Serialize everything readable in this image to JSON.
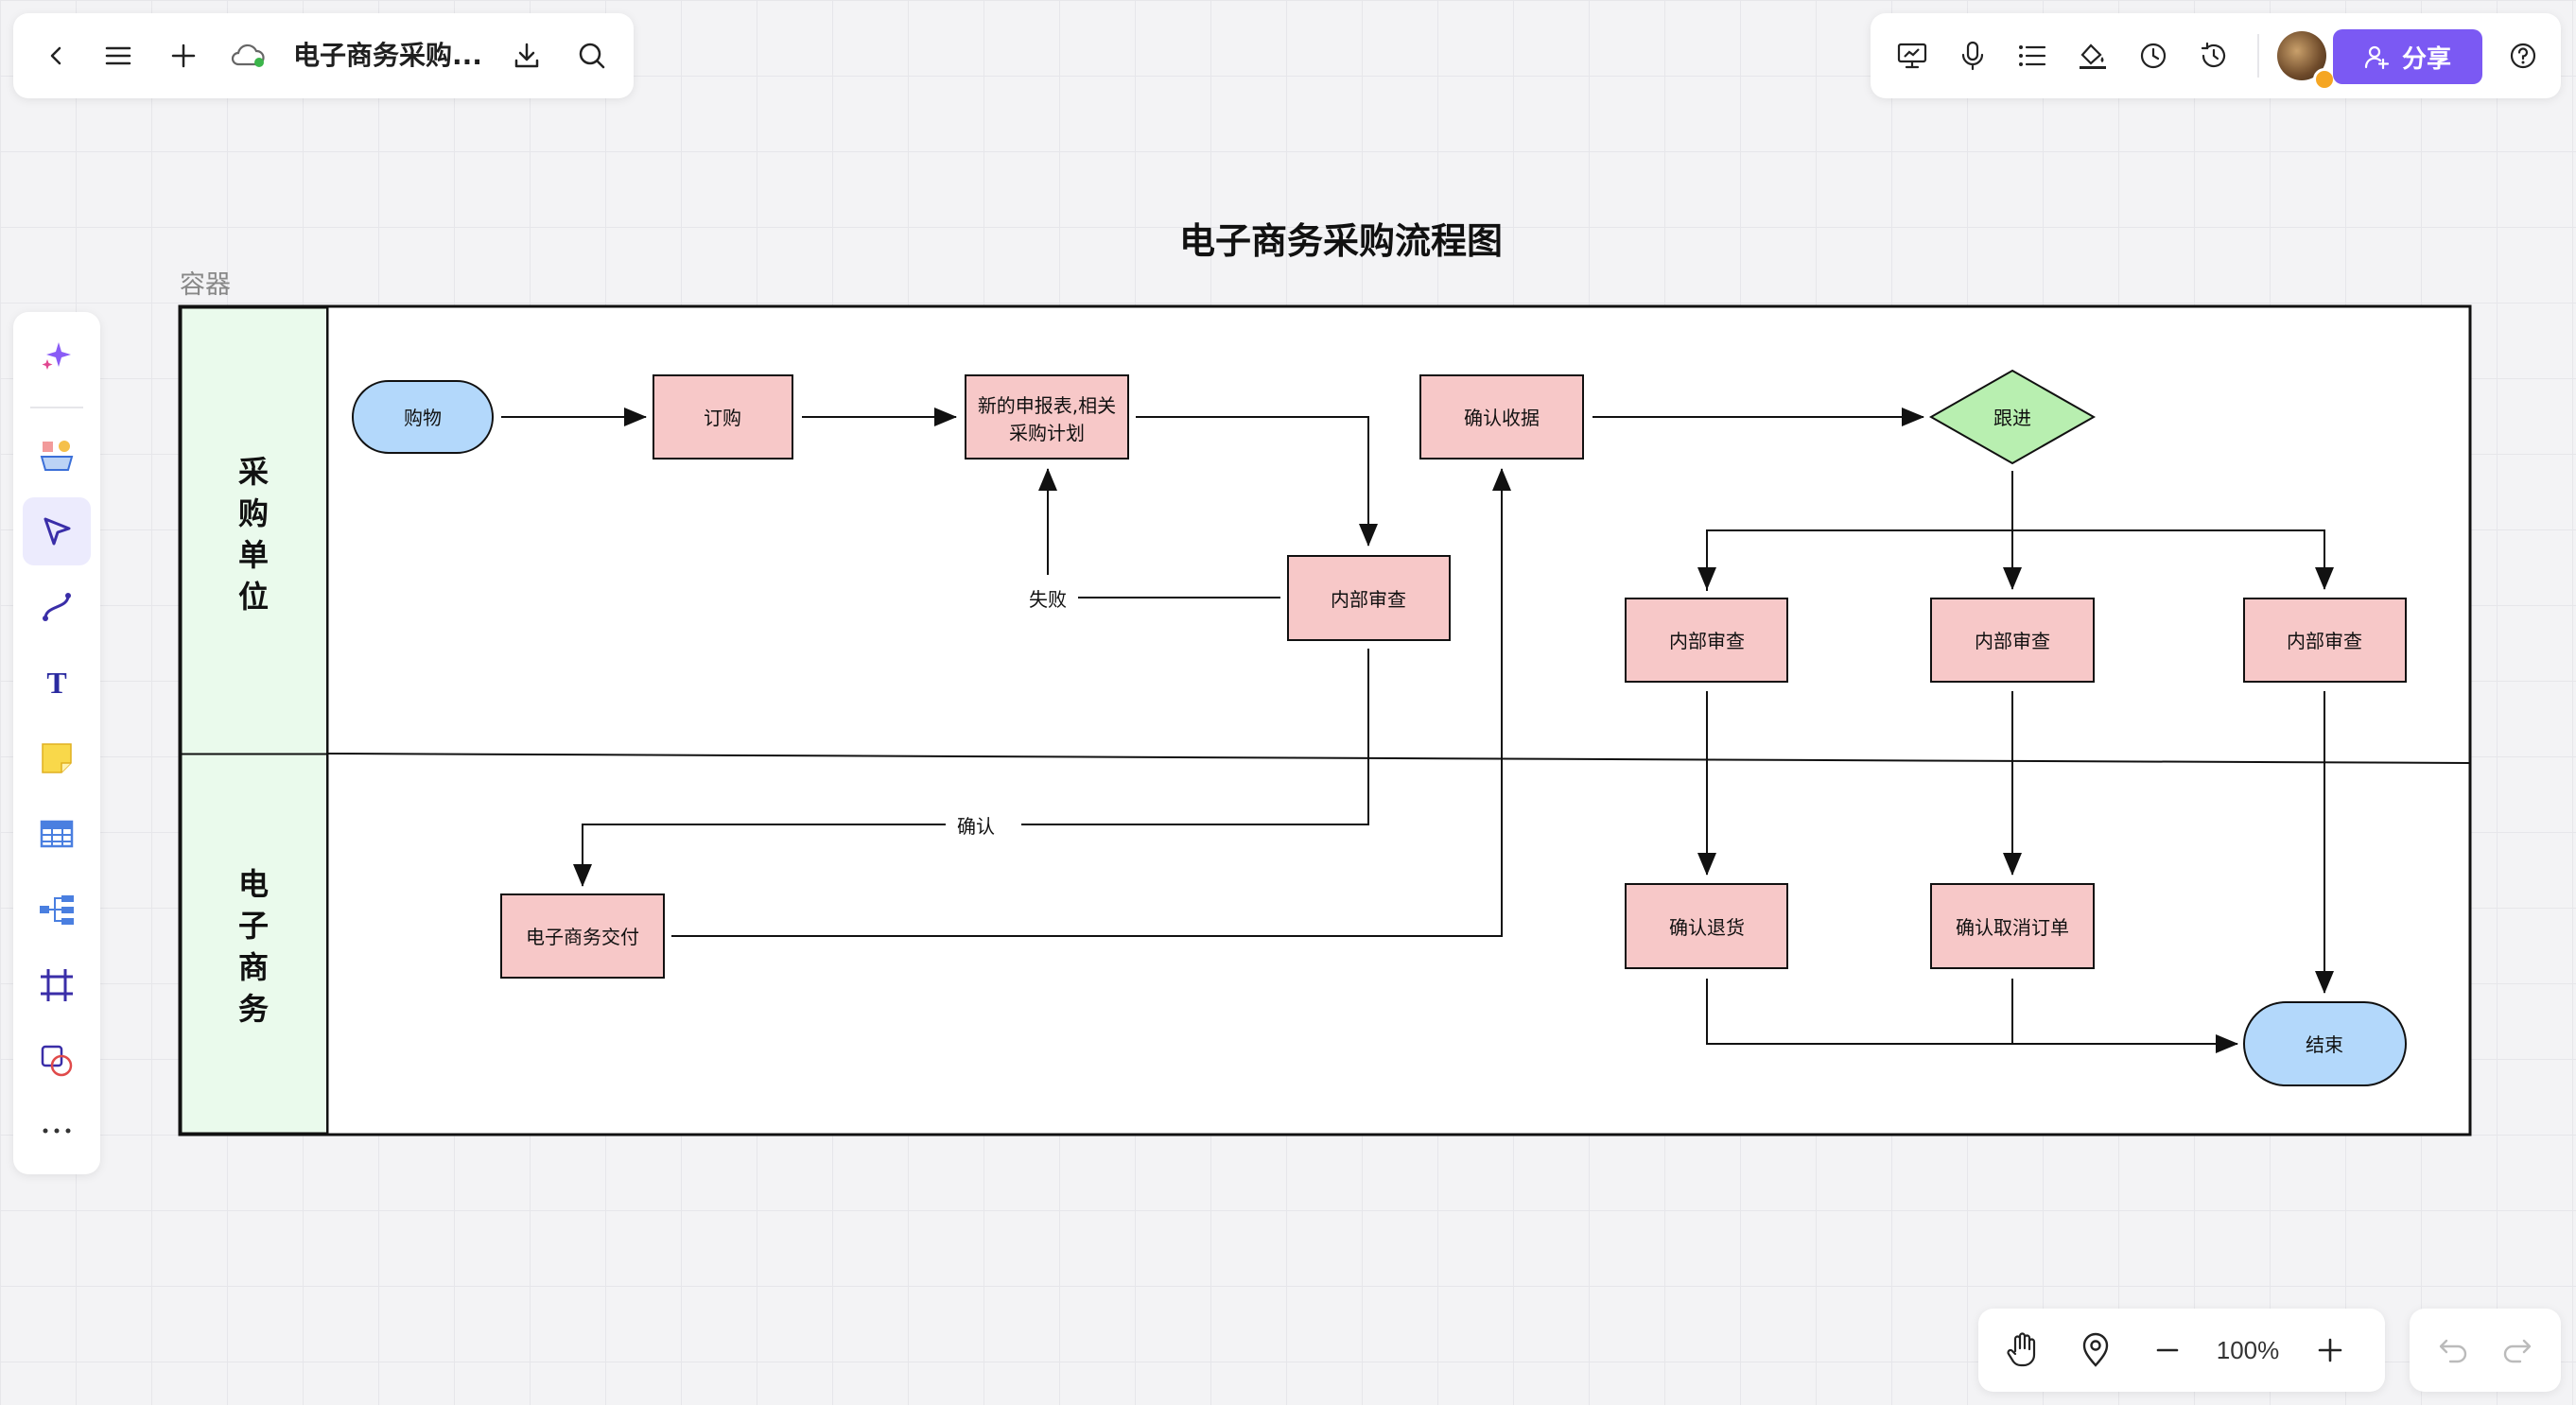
{
  "toolbar_left": {
    "doc_title": "电子商务采购...",
    "buttons": [
      "back-icon",
      "menu-icon",
      "plus-icon",
      "cloud-sync-icon",
      "download-icon",
      "search-icon"
    ]
  },
  "toolbar_right": {
    "share_label": "分享",
    "icons": [
      "presentation-icon",
      "microphone-icon",
      "list-icon",
      "fill-bucket-icon",
      "clock-icon",
      "history-icon",
      "help-icon"
    ],
    "accent_color": "#7b59f3"
  },
  "left_tools": [
    "ai-sparkle-icon",
    "template-icon",
    "select-cursor-icon",
    "connector-icon",
    "text-icon",
    "sticky-note-icon",
    "table-icon",
    "mindmap-icon",
    "frame-icon",
    "shapes-icon",
    "more-icon"
  ],
  "zoom": {
    "label": "100%"
  },
  "diagram": {
    "title": "电子商务采购流程图",
    "container_label": "容器",
    "lanes": [
      {
        "label": "采\n购\n单\n位"
      },
      {
        "label": "电\n子\n商\n务"
      }
    ],
    "nodes": {
      "gouwu": "购物",
      "dinggou": "订购",
      "shenbao_line1": "新的申报表,相关",
      "shenbao_line2": "采购计划",
      "queren_shouju": "确认收据",
      "genjin": "跟进",
      "neibu_shencha_1": "内部审查",
      "neibu_shencha_2": "内部审查",
      "neibu_shencha_3": "内部审查",
      "neibu_shencha_4": "内部审查",
      "dianzi_jiaofu": "电子商务交付",
      "queren_tuihuo": "确认退货",
      "queren_quxiao": "确认取消订单",
      "jieshu": "结束"
    },
    "edge_labels": {
      "shibai": "失败",
      "queren": "确认"
    },
    "colors": {
      "process": "#f7c8c8",
      "terminal": "#b3d8fb",
      "decision": "#b8efb0",
      "lane_header": "#eafaec"
    }
  }
}
